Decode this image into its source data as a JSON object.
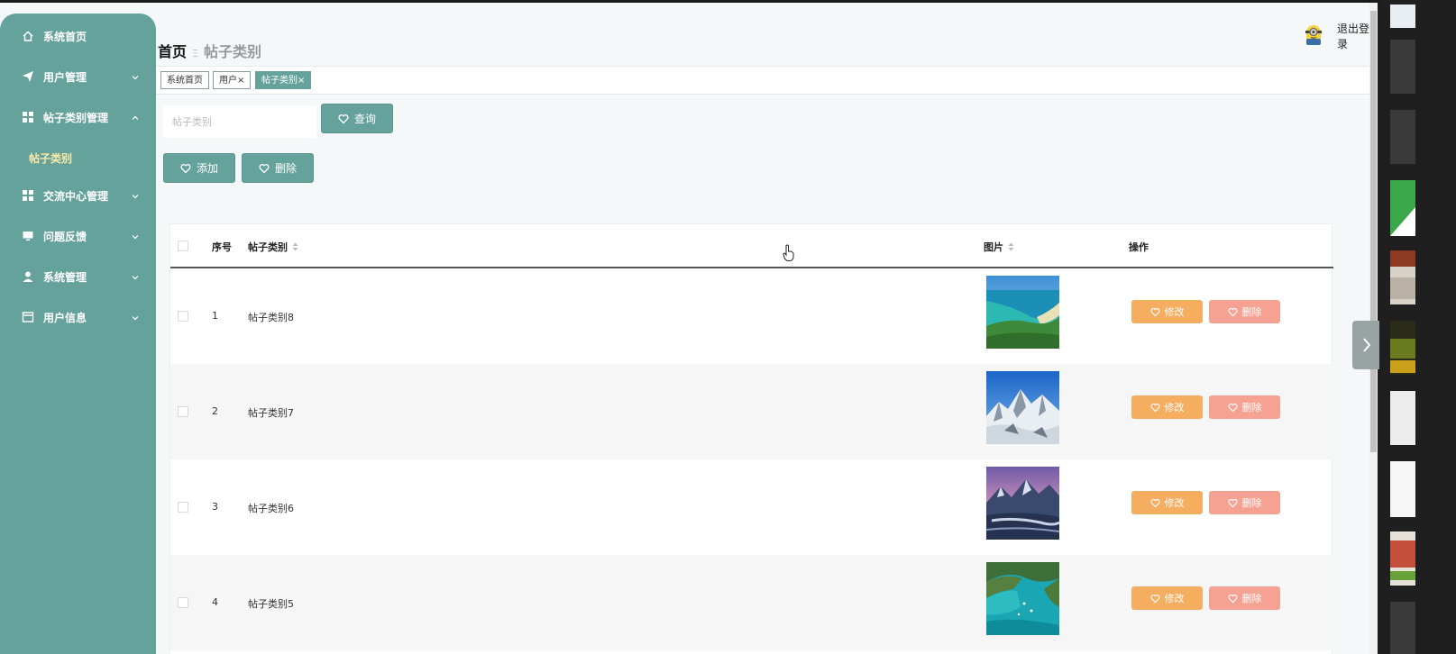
{
  "sidebar": {
    "items": [
      {
        "label": "系统首页",
        "icon": "home-icon"
      },
      {
        "label": "用户管理",
        "icon": "paper-plane-icon"
      },
      {
        "label": "帖子类别管理",
        "icon": "grid-icon"
      },
      {
        "label": "交流中心管理",
        "icon": "grid-icon"
      },
      {
        "label": "问题反馈",
        "icon": "monitor-icon"
      },
      {
        "label": "系统管理",
        "icon": "user-icon"
      },
      {
        "label": "用户信息",
        "icon": "card-icon"
      }
    ],
    "submenu_active": "帖子类别"
  },
  "header": {
    "breadcrumb_home": "首页",
    "breadcrumb_current": "帖子类别",
    "logout_label": "退出登录"
  },
  "tags": [
    {
      "label": "系统首页",
      "active": false
    },
    {
      "label": "用户×",
      "active": false
    },
    {
      "label": "帖子类别×",
      "active": true
    }
  ],
  "search": {
    "placeholder": "帖子类别",
    "value": "",
    "query_label": "查询",
    "add_label": "添加",
    "delete_label": "删除"
  },
  "table": {
    "columns": {
      "index": "序号",
      "category": "帖子类别",
      "image": "图片",
      "actions": "操作"
    },
    "edit_label": "修改",
    "delete_label": "删除",
    "rows": [
      {
        "index": "1",
        "category": "帖子类别8",
        "image": "coastline-photo"
      },
      {
        "index": "2",
        "category": "帖子类别7",
        "image": "snowy-mountains-photo"
      },
      {
        "index": "3",
        "category": "帖子类别6",
        "image": "mountain-lake-dusk-photo"
      },
      {
        "index": "4",
        "category": "帖子类别5",
        "image": "turquoise-bay-photo"
      }
    ]
  },
  "colors": {
    "accent": "#66a29c",
    "edit": "#f5ad60",
    "delete": "#f5a293",
    "submenu_active": "#fbe8a6"
  }
}
